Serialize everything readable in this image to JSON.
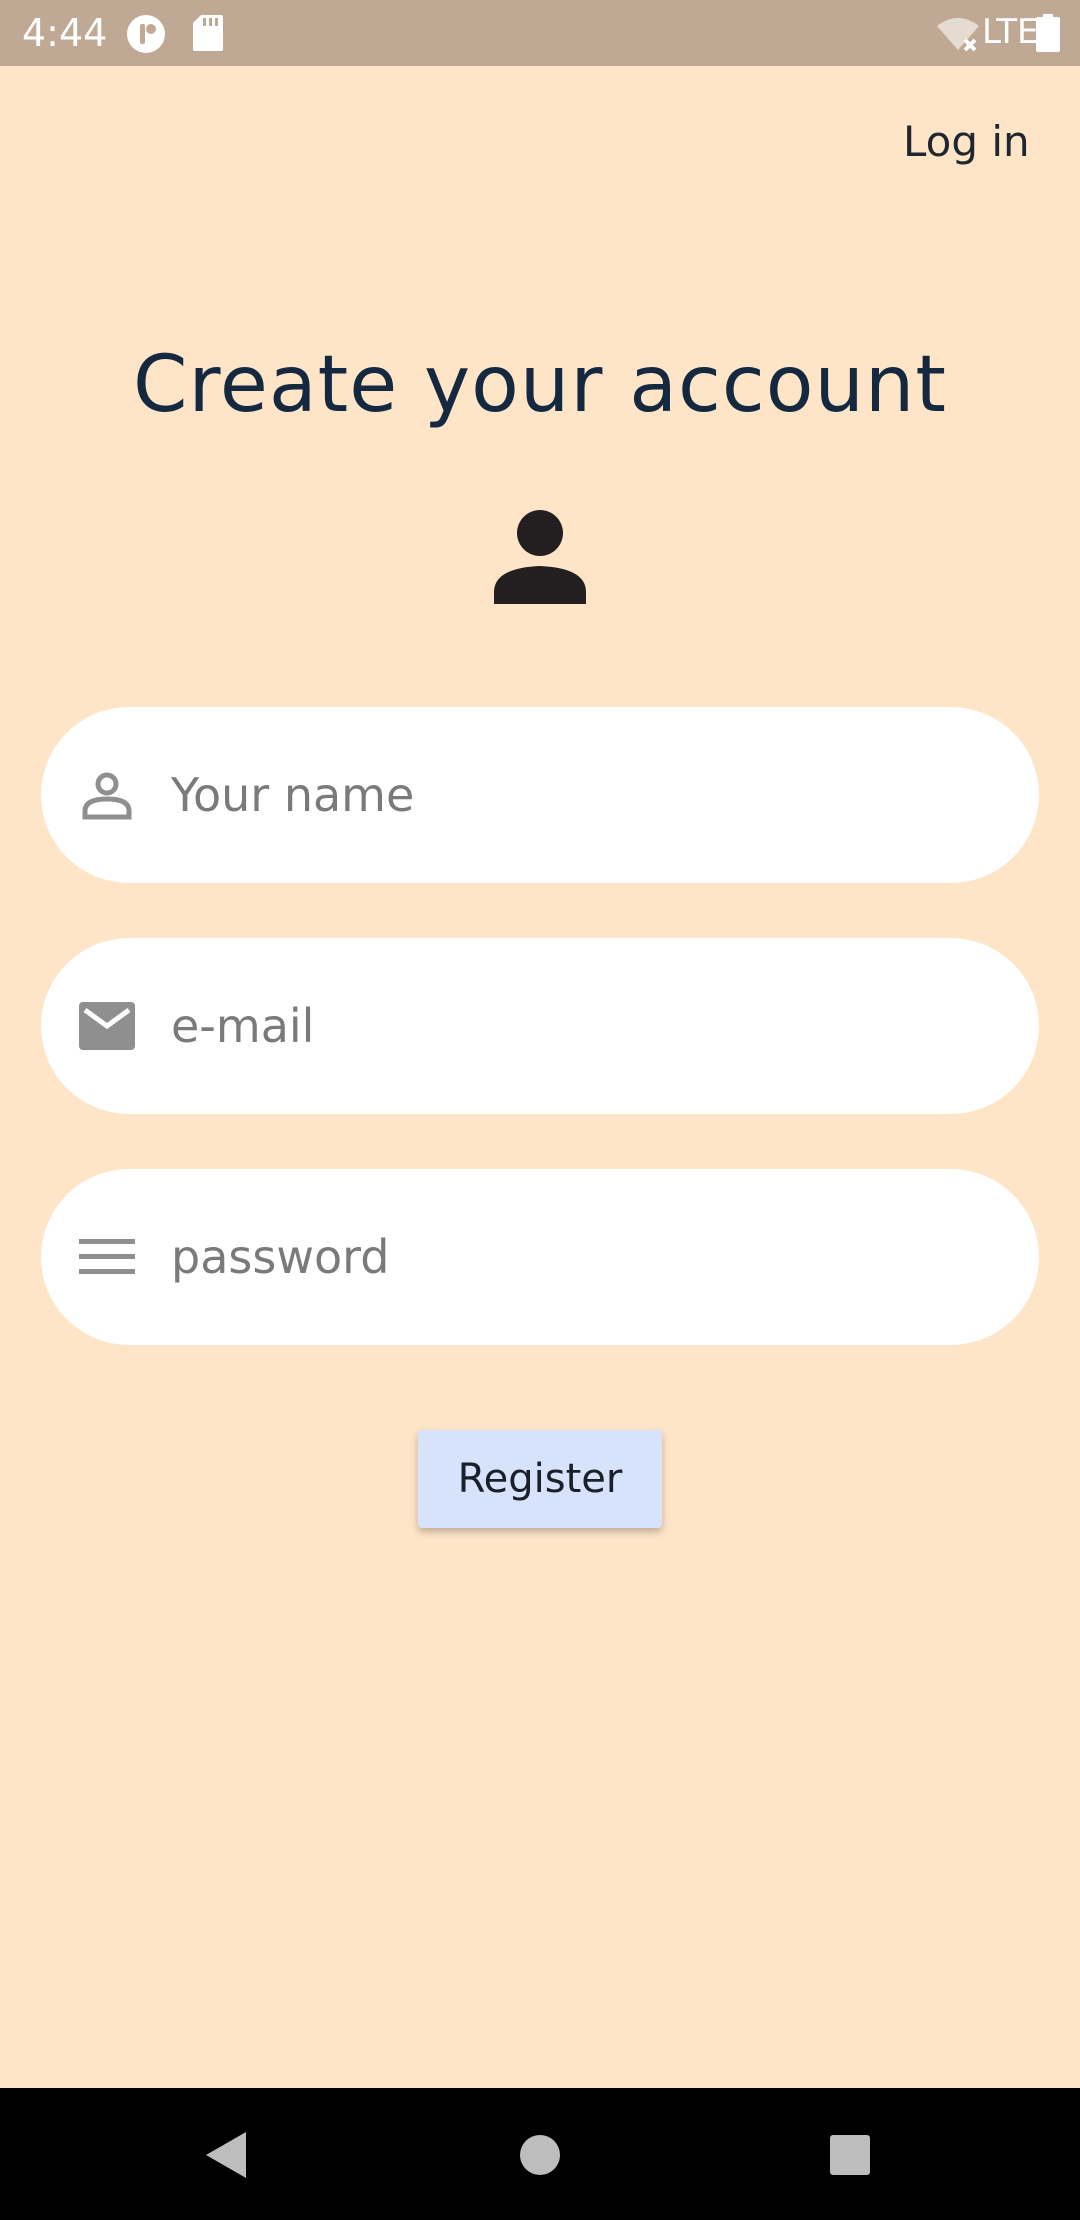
{
  "status_bar": {
    "time": "4:44",
    "network_label": "LTE",
    "icons": [
      "app-notification-icon",
      "sd-card-icon",
      "wifi-off-icon",
      "battery-icon"
    ]
  },
  "header": {
    "login_label": "Log in"
  },
  "main": {
    "title": "Create your account",
    "avatar_icon": "person-icon"
  },
  "form": {
    "name": {
      "placeholder": "Your name",
      "value": "",
      "icon": "person-outline-icon"
    },
    "email": {
      "placeholder": "e-mail",
      "value": "",
      "icon": "mail-icon"
    },
    "password": {
      "placeholder": "password",
      "value": "",
      "icon": "menu-lines-icon"
    },
    "register_label": "Register"
  },
  "nav_bar": {
    "icons": [
      "back-icon",
      "home-icon",
      "recents-icon"
    ]
  },
  "colors": {
    "background": "#ffe5c8",
    "status_bar": "#c0a994",
    "title": "#142840",
    "button": "#d7e3fb",
    "field": "#ffffff",
    "icon_gray": "#8f8f8f"
  }
}
